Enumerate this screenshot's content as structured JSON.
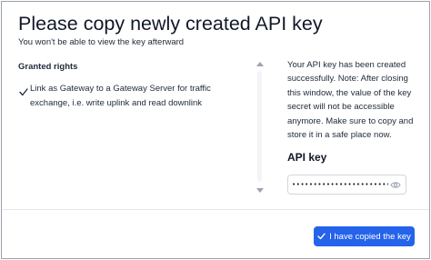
{
  "dialog": {
    "title": "Please copy newly created API key",
    "subtitle": "You won't be able to view the key afterward"
  },
  "rights": {
    "heading": "Granted rights",
    "items": [
      {
        "text": "Link as Gateway to a Gateway Server for traffic exchange, i.e. write uplink and read downlink",
        "icon": "check-icon"
      }
    ]
  },
  "info": {
    "message": "Your API key has been created successfully. Note: After closing this window, the value of the key secret will not be accessible anymore. Make sure to copy and store it in a safe place now."
  },
  "api_key": {
    "label": "API key",
    "masked_value": "•••••••••••••••••••••••••••",
    "toggle_icon": "eye-icon"
  },
  "footer": {
    "confirm_label": "I have copied the key",
    "confirm_icon": "check-icon"
  },
  "colors": {
    "primary": "#2563eb",
    "text": "#1f2937",
    "border": "#d1d5db"
  }
}
